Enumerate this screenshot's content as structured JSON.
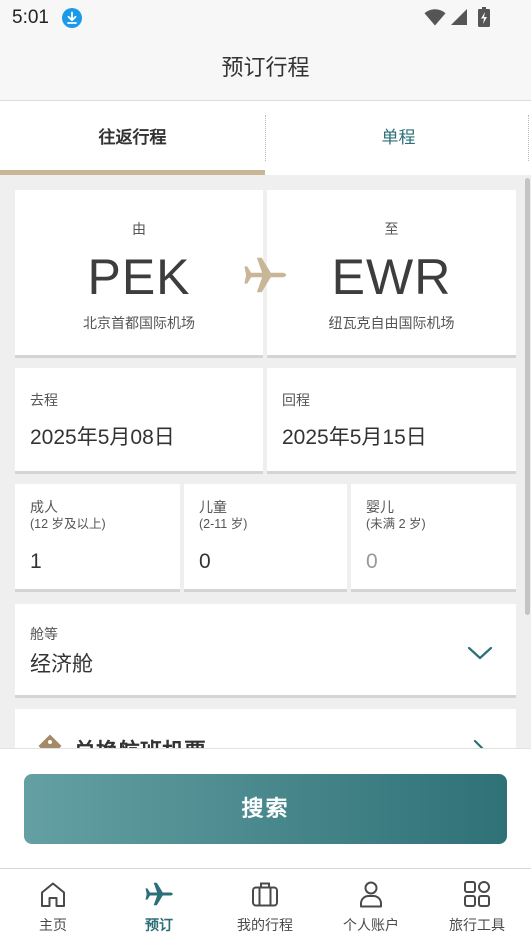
{
  "status_bar": {
    "time": "5:01",
    "icons": [
      "download-icon",
      "wifi-icon",
      "signal-icon",
      "battery-icon"
    ]
  },
  "header": {
    "title": "预订行程"
  },
  "tabs": [
    {
      "label": "往返行程",
      "selected": true
    },
    {
      "label": "单程",
      "selected": false
    }
  ],
  "route": {
    "origin": {
      "label": "由",
      "code": "PEK",
      "airport": "北京首都国际机场"
    },
    "destination": {
      "label": "至",
      "code": "EWR",
      "airport": "纽瓦克自由国际机场"
    },
    "separator_icon": "airplane-icon"
  },
  "dates": {
    "departure": {
      "label": "去程",
      "value": "2025年5月08日"
    },
    "return": {
      "label": "回程",
      "value": "2025年5月15日"
    }
  },
  "passengers": [
    {
      "label": "成人",
      "age_note": "(12 岁及以上)",
      "count": "1"
    },
    {
      "label": "儿童",
      "age_note": "(2-11 岁)",
      "count": "0"
    },
    {
      "label": "婴儿",
      "age_note": "(未满 2 岁)",
      "count": "0"
    }
  ],
  "cabin": {
    "label": "舱等",
    "value": "经济舱",
    "icon": "chevron-down-icon"
  },
  "redeem": {
    "label": "兑换航班机票",
    "icon": "ticket-icon",
    "arrow_icon": "chevron-right-icon"
  },
  "search_button": {
    "label": "搜索"
  },
  "bottom_nav": [
    {
      "label": "主页",
      "icon": "home-icon",
      "selected": false
    },
    {
      "label": "预订",
      "icon": "airplane-icon",
      "selected": true
    },
    {
      "label": "我的行程",
      "icon": "suitcase-icon",
      "selected": false
    },
    {
      "label": "个人账户",
      "icon": "person-icon",
      "selected": false
    },
    {
      "label": "旅行工具",
      "icon": "grid-icon",
      "selected": false
    }
  ],
  "colors": {
    "accent": "#2b6f79",
    "tan": "#c8b697",
    "download_badge": "#1a9ae8",
    "button_start": "#64a0a3",
    "button_end": "#2e7177",
    "background": "#efefef"
  }
}
